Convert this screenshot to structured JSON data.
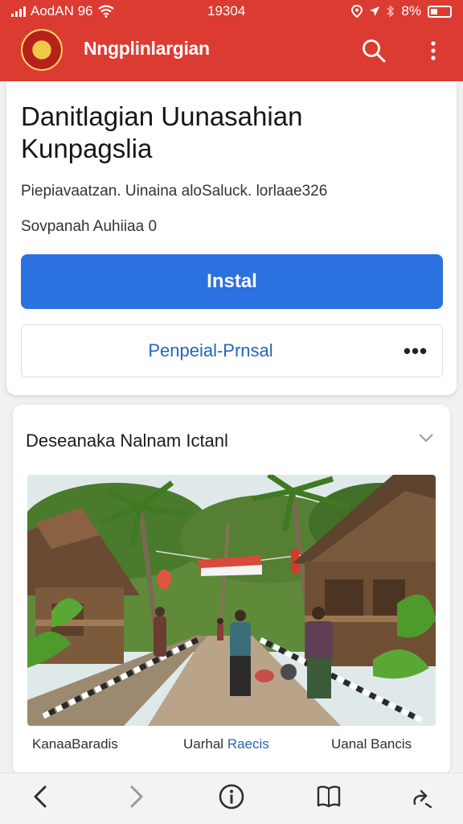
{
  "status_bar": {
    "left_text": "AodAN 96",
    "time": "19304",
    "battery": "8%"
  },
  "app_bar": {
    "title": "Nngplinlargian",
    "icons": [
      "logo",
      "search-icon",
      "more-vert-icon"
    ],
    "color": "#dc3b32"
  },
  "app_card": {
    "name": "Danitlagian Uunasahian Kunpagslia",
    "meta_line_1": "Piepiavaatzan. Uinaina aloSaluck. lorlaae326",
    "meta_line_2": "Sovpanah Auhiiaa 0",
    "install_label": "Instal",
    "secondary_label": "Penpeial-Prnsal",
    "secondary_more": "•••",
    "accent": "#2b71e0"
  },
  "gallery_section": {
    "title": "Deseanaka Nalnam Ictanl",
    "captions": [
      "KanaaBaradis",
      "Uarhal",
      "Raecis",
      "Uanal Bancis"
    ]
  },
  "bottom_nav": {
    "icons": [
      "back-icon",
      "forward-icon",
      "info-icon",
      "bookmarks-icon",
      "share-icon"
    ]
  }
}
